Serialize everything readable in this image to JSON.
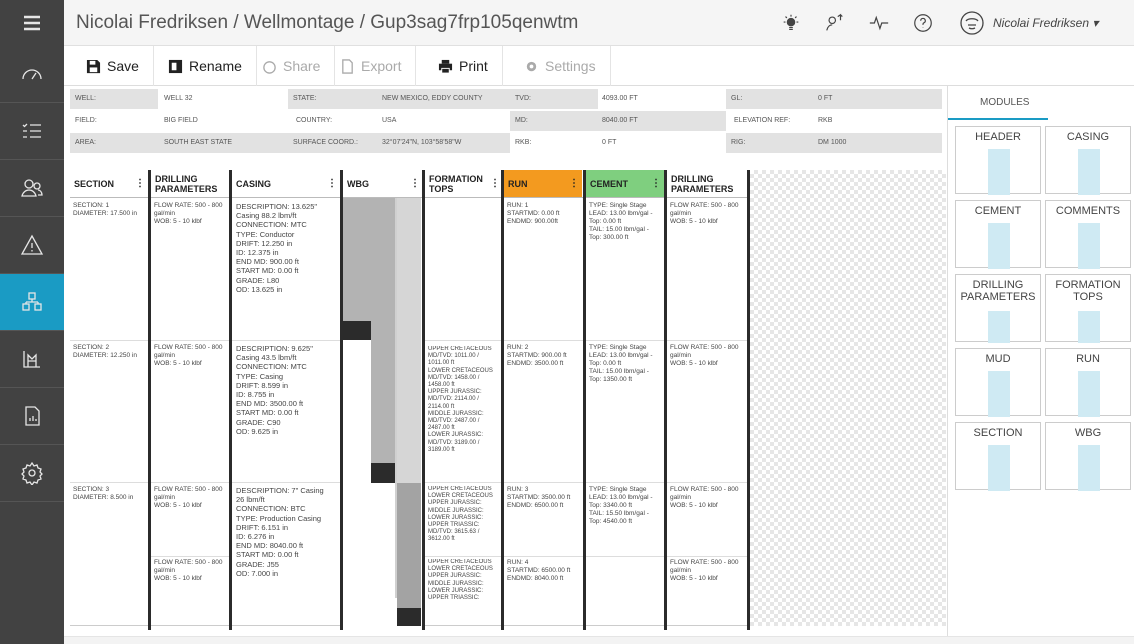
{
  "header": {
    "title": "Nicolai Fredriksen / Wellmontage / Gup3sag7frp105qenwtm",
    "user": "Nicolai Fredriksen ▾"
  },
  "sidebar": {
    "items": [
      {
        "icon": "menu-icon"
      },
      {
        "icon": "gauge-icon"
      },
      {
        "icon": "checklist-icon"
      },
      {
        "icon": "users-icon"
      },
      {
        "icon": "warning-icon"
      },
      {
        "icon": "schematic-icon",
        "active": true
      },
      {
        "icon": "rig-icon"
      },
      {
        "icon": "report-icon"
      },
      {
        "icon": "settings-icon"
      }
    ]
  },
  "toolbar": {
    "save": "Save",
    "rename": "Rename",
    "share": "Share",
    "export": "Export",
    "print": "Print",
    "settings": "Settings"
  },
  "info": {
    "well_label": "WELL:",
    "well": "WELL 32",
    "state_label": "STATE:",
    "state": "NEW MEXICO, EDDY COUNTY",
    "tvd_label": "TVD:",
    "tvd": "4093.00 FT",
    "gl_label": "GL:",
    "gl": "0 FT",
    "field_label": "FIELD:",
    "field": "BIG FIELD",
    "country_label": "COUNTRY:",
    "country": "USA",
    "md_label": "MD:",
    "md": "8040.00 FT",
    "elev_label": "ELEVATION REF:",
    "elev": "RKB",
    "area_label": "AREA:",
    "area": "SOUTH EAST STATE",
    "coord_label": "SURFACE COORD.:",
    "coord": "32°07'24\"N, 103°58'58\"W",
    "rkb_label": "RKB:",
    "rkb": "0 FT",
    "rig_label": "RIG:",
    "rig": "DM 1000"
  },
  "columns": {
    "section": "SECTION",
    "drilling": "DRILLING PARAMETERS",
    "casing": "CASING",
    "wbg": "WBG",
    "formation": "FORMATION TOPS",
    "run": "RUN",
    "cement": "CEMENT",
    "drilling2": "DRILLING PARAMETERS",
    "colors": {
      "run": "#f39a1f",
      "cement": "#7fcf7f"
    }
  },
  "rows": [
    {
      "section": "SECTION: 1\nDIAMETER: 17.500 in",
      "drilling": "FLOW RATE: 500 - 800\ngal/min\nWOB: 5 - 10 klbf",
      "casing": "DESCRIPTION: 13.625\"\nCasing 88.2 lbm/ft\nCONNECTION: MTC\nTYPE: Conductor\nDRIFT: 12.250 in\nID: 12.375 in\nEND MD: 900.00 ft\nSTART MD: 0.00 ft\nGRADE: L80\nOD: 13.625 in",
      "formation": "",
      "run": "RUN: 1\nSTARTMD: 0.00 ft\nENDMD: 900.00ft",
      "cement": "TYPE: Single Stage\nLEAD: 13.00 lbm/gal -\nTop: 0.00 ft\nTAIL: 15.00 lbm/gal -\nTop: 300.00 ft",
      "drilling2": "FLOW RATE: 500 - 800\ngal/min\nWOB: 5 - 10 klbf"
    },
    {
      "section": "SECTION: 2\nDIAMETER: 12.250 in",
      "drilling": "FLOW RATE: 500 - 800\ngal/min\nWOB: 5 - 10 klbf",
      "casing": "DESCRIPTION: 9.625\"\nCasing 43.5 lbm/ft\nCONNECTION: MTC\nTYPE: Casing\nDRIFT: 8.599 in\nID: 8.755 in\nEND MD: 3500.00 ft\nSTART MD: 0.00 ft\nGRADE: C90\nOD: 9.625 in",
      "formation": "UPPER CRETACEOUS\nMD/TVD: 1011.00 /\n1011.00 ft\nLOWER CRETACEOUS\nMD/TVD: 1458.00 /\n1458.00 ft\nUPPER JURASSIC:\nMD/TVD: 2114.00 /\n2114.00 ft\nMIDDLE JURASSIC:\nMD/TVD: 2487.00 /\n2487.00 ft\nLOWER JURASSIC:\nMD/TVD: 3189.00 /\n3189.00 ft",
      "run": "RUN: 2\nSTARTMD: 900.00 ft\nENDMD: 3500.00 ft",
      "cement": "TYPE: Single Stage\nLEAD: 13.00 lbm/gal -\nTop: 0.00 ft\nTAIL: 15.00 lbm/gal -\nTop: 1350.00 ft",
      "drilling2": "FLOW RATE: 500 - 800\ngal/min\nWOB: 5 - 10 klbf"
    },
    {
      "section": "SECTION: 3\nDIAMETER: 8.500 in",
      "drilling": "FLOW RATE: 500 - 800\ngal/min\nWOB: 5 - 10 klbf",
      "casing": "DESCRIPTION: 7\" Casing\n26 lbm/ft\nCONNECTION: BTC\nTYPE: Production Casing\nDRIFT: 6.151 in\nID: 6.276 in\nEND MD: 8040.00 ft\nSTART MD: 0.00 ft\nGRADE: J55\nOD: 7.000 in",
      "formation": "UPPER CRETACEOUS\nLOWER CRETACEOUS\nUPPER JURASSIC:\nMIDDLE JURASSIC:\nLOWER JURASSIC:\nUPPER TRIASSIC:\nMD/TVD: 3615.63 /\n3612.00 ft",
      "run": "RUN: 3\nSTARTMD: 3500.00 ft\nENDMD: 6500.00 ft",
      "cement": "TYPE: Single Stage\nLEAD: 13.00 lbm/gal -\nTop: 3340.00 ft\nTAIL: 15.50 lbm/gal -\nTop: 4540.00 ft",
      "drilling2": "FLOW RATE: 500 - 800\ngal/min\nWOB: 5 - 10 klbf"
    },
    {
      "drilling": "FLOW RATE: 500 - 800\ngal/min\nWOB: 5 - 10 klbf",
      "formation": "UPPER CRETACEOUS\nLOWER CRETACEOUS\nUPPER JURASSIC:\nMIDDLE JURASSIC:\nLOWER JURASSIC:\nUPPER TRIASSIC:",
      "run": "RUN: 4\nSTARTMD: 6500.00 ft\nENDMD: 8040.00 ft",
      "drilling2": "FLOW RATE: 500 - 800\ngal/min\nWOB: 5 - 10 klbf"
    }
  ],
  "modules": {
    "tab": "MODULES",
    "cards": [
      "HEADER",
      "CASING",
      "CEMENT",
      "COMMENTS",
      "DRILLING PARAMETERS",
      "FORMATION TOPS",
      "MUD",
      "RUN",
      "SECTION",
      "WBG"
    ]
  }
}
